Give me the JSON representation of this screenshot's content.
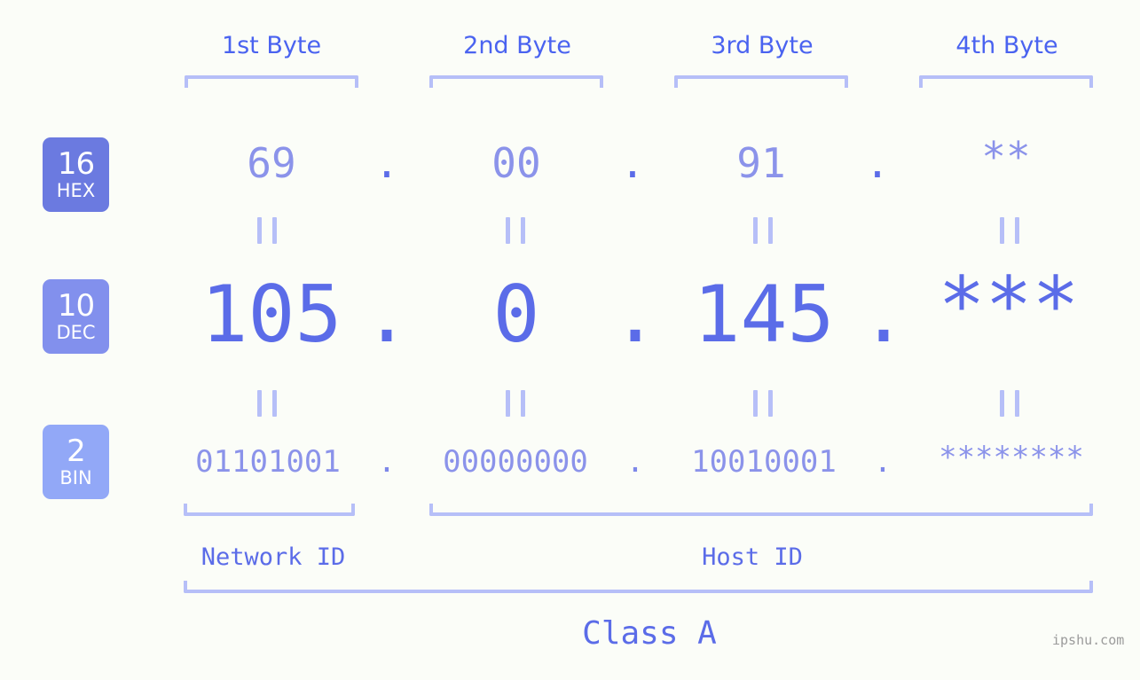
{
  "meta": {
    "background_color": "#fbfdf8",
    "accent_dark": "#5b6ce8",
    "accent_mid": "#8b93ea",
    "accent_light": "#b6bff8",
    "watermark": "ipshu.com"
  },
  "byte_headers": [
    {
      "label": "1st Byte"
    },
    {
      "label": "2nd Byte"
    },
    {
      "label": "3rd Byte"
    },
    {
      "label": "4th Byte"
    }
  ],
  "bases": [
    {
      "num": "16",
      "abbr": "HEX",
      "color": "#6b7ae0"
    },
    {
      "num": "10",
      "abbr": "DEC",
      "color": "#8290ed"
    },
    {
      "num": "2",
      "abbr": "BIN",
      "color": "#92a8f7"
    }
  ],
  "rows": {
    "hex": {
      "values": [
        "69",
        "00",
        "91",
        "**"
      ],
      "separator": "."
    },
    "dec": {
      "values": [
        "105",
        "0",
        "145",
        "***"
      ],
      "separator": "."
    },
    "bin": {
      "values": [
        "01101001",
        "00000000",
        "10010001",
        "********"
      ],
      "separator": "."
    }
  },
  "equals_marks": {
    "symbol": "||",
    "count_per_row": 4
  },
  "segments": [
    {
      "label": "Network ID"
    },
    {
      "label": "Host ID"
    }
  ],
  "class": {
    "label": "Class A"
  }
}
